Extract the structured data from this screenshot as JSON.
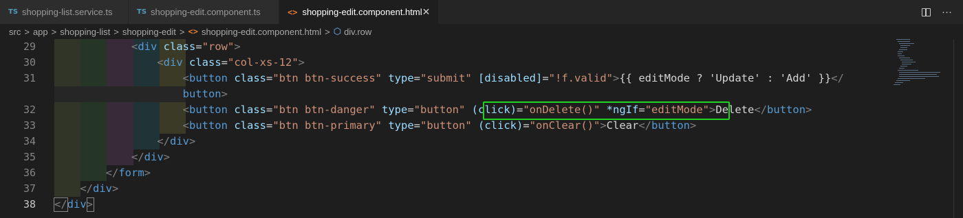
{
  "tabs": [
    {
      "badge": "TS",
      "label": "shopping-list.service.ts"
    },
    {
      "badge": "TS",
      "label": "shopping-edit.component.ts"
    },
    {
      "badge": "<>",
      "label": "shopping-edit.component.html",
      "close": "✕"
    }
  ],
  "breadcrumb": {
    "items": [
      "src",
      "app",
      "shopping-list",
      "shopping-edit"
    ],
    "file_badge": "<>",
    "file": "shopping-edit.component.html",
    "symbol_icon": "cube-icon",
    "symbol": "div.row",
    "separator": ">"
  },
  "editor": {
    "current_line": "38",
    "highlight_color": "#1ed41e",
    "lines": [
      {
        "num": "29",
        "indent": "            ",
        "html_parts": [
          [
            "br",
            "<"
          ],
          [
            "tg",
            "div"
          ],
          [
            "tx",
            " "
          ],
          [
            "at",
            "class"
          ],
          [
            "tx",
            "="
          ],
          [
            "st",
            "\"row\""
          ],
          [
            "br",
            ">"
          ]
        ]
      },
      {
        "num": "30",
        "indent": "                ",
        "html_parts": [
          [
            "br",
            "<"
          ],
          [
            "tg",
            "div"
          ],
          [
            "tx",
            " "
          ],
          [
            "at",
            "class"
          ],
          [
            "tx",
            "="
          ],
          [
            "st",
            "\"col-xs-12\""
          ],
          [
            "br",
            ">"
          ]
        ]
      },
      {
        "num": "31",
        "indent": "                    ",
        "html_parts": [
          [
            "br",
            "<"
          ],
          [
            "tg",
            "button"
          ],
          [
            "tx",
            " "
          ],
          [
            "at",
            "class"
          ],
          [
            "tx",
            "="
          ],
          [
            "st",
            "\"btn btn-success\""
          ],
          [
            "tx",
            " "
          ],
          [
            "at",
            "type"
          ],
          [
            "tx",
            "="
          ],
          [
            "st",
            "\"submit\""
          ],
          [
            "tx",
            " "
          ],
          [
            "at",
            "[disabled]"
          ],
          [
            "tx",
            "="
          ],
          [
            "st",
            "\"!f.valid\""
          ],
          [
            "br",
            ">"
          ],
          [
            "tx",
            "{{ editMode ? 'Update' : 'Add' }}"
          ],
          [
            "br",
            "</"
          ]
        ]
      },
      {
        "num": "",
        "indent": "                    ",
        "html_parts": [
          [
            "tg",
            "button"
          ],
          [
            "br",
            ">"
          ]
        ]
      },
      {
        "num": "32",
        "indent": "                    ",
        "html_parts": [
          [
            "br",
            "<"
          ],
          [
            "tg",
            "button"
          ],
          [
            "tx",
            " "
          ],
          [
            "at",
            "class"
          ],
          [
            "tx",
            "="
          ],
          [
            "st",
            "\"btn btn-danger\""
          ],
          [
            "tx",
            " "
          ],
          [
            "at",
            "type"
          ],
          [
            "tx",
            "="
          ],
          [
            "st",
            "\"button\""
          ],
          [
            "tx",
            " "
          ],
          [
            "at",
            "(click)"
          ],
          [
            "tx",
            "="
          ],
          [
            "st",
            "\"onDelete()\""
          ],
          [
            "tx",
            " "
          ],
          [
            "at",
            "*ngIf"
          ],
          [
            "tx",
            "="
          ],
          [
            "st",
            "\"editMode\""
          ],
          [
            "br",
            ">"
          ],
          [
            "tx",
            "Delete"
          ],
          [
            "br",
            "</"
          ],
          [
            "tg",
            "button"
          ],
          [
            "br",
            ">"
          ]
        ]
      },
      {
        "num": "33",
        "indent": "                    ",
        "html_parts": [
          [
            "br",
            "<"
          ],
          [
            "tg",
            "button"
          ],
          [
            "tx",
            " "
          ],
          [
            "at",
            "class"
          ],
          [
            "tx",
            "="
          ],
          [
            "st",
            "\"btn btn-primary\""
          ],
          [
            "tx",
            " "
          ],
          [
            "at",
            "type"
          ],
          [
            "tx",
            "="
          ],
          [
            "st",
            "\"button\""
          ],
          [
            "tx",
            " "
          ],
          [
            "at",
            "(click)"
          ],
          [
            "tx",
            "="
          ],
          [
            "st",
            "\"onClear()\""
          ],
          [
            "br",
            ">"
          ],
          [
            "tx",
            "Clear"
          ],
          [
            "br",
            "</"
          ],
          [
            "tg",
            "button"
          ],
          [
            "br",
            ">"
          ]
        ]
      },
      {
        "num": "34",
        "indent": "                ",
        "html_parts": [
          [
            "br",
            "</"
          ],
          [
            "tg",
            "div"
          ],
          [
            "br",
            ">"
          ]
        ]
      },
      {
        "num": "35",
        "indent": "            ",
        "html_parts": [
          [
            "br",
            "</"
          ],
          [
            "tg",
            "div"
          ],
          [
            "br",
            ">"
          ]
        ]
      },
      {
        "num": "36",
        "indent": "        ",
        "html_parts": [
          [
            "br",
            "</"
          ],
          [
            "tg",
            "form"
          ],
          [
            "br",
            ">"
          ]
        ]
      },
      {
        "num": "37",
        "indent": "    ",
        "html_parts": [
          [
            "br",
            "</"
          ],
          [
            "tg",
            "div"
          ],
          [
            "br",
            ">"
          ]
        ]
      },
      {
        "num": "38",
        "indent": "",
        "html_parts": [
          [
            "br",
            "</"
          ],
          [
            "tg",
            "div"
          ],
          [
            "br",
            ">"
          ]
        ]
      }
    ]
  }
}
